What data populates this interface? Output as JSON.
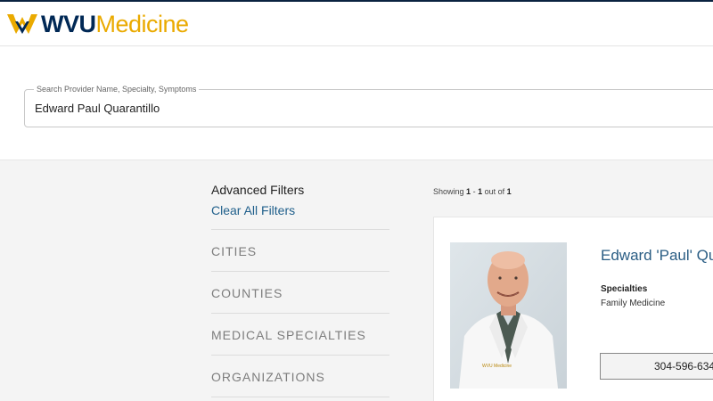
{
  "header": {
    "logo_wvu": "WVU",
    "logo_medicine": "Medicine",
    "brand_colors": {
      "navy": "#002855",
      "gold": "#EAAA00"
    }
  },
  "search": {
    "label": "Search Provider Name, Specialty, Symptoms",
    "value": "Edward Paul Quarantillo"
  },
  "filters": {
    "title": "Advanced Filters",
    "clear_label": "Clear All Filters",
    "items": [
      {
        "label": "CITIES"
      },
      {
        "label": "COUNTIES"
      },
      {
        "label": "MEDICAL SPECIALTIES"
      },
      {
        "label": "ORGANIZATIONS"
      }
    ]
  },
  "results": {
    "showing_prefix": "Showing",
    "range_start": "1",
    "range_sep": " - ",
    "range_end": "1",
    "out_of_label": "out of",
    "total": "1"
  },
  "provider": {
    "name": "Edward 'Paul' Qu",
    "specialties_label": "Specialties",
    "specialty": "Family Medicine",
    "phone": "304-596-634",
    "coat_text": "WVU Medicine"
  }
}
